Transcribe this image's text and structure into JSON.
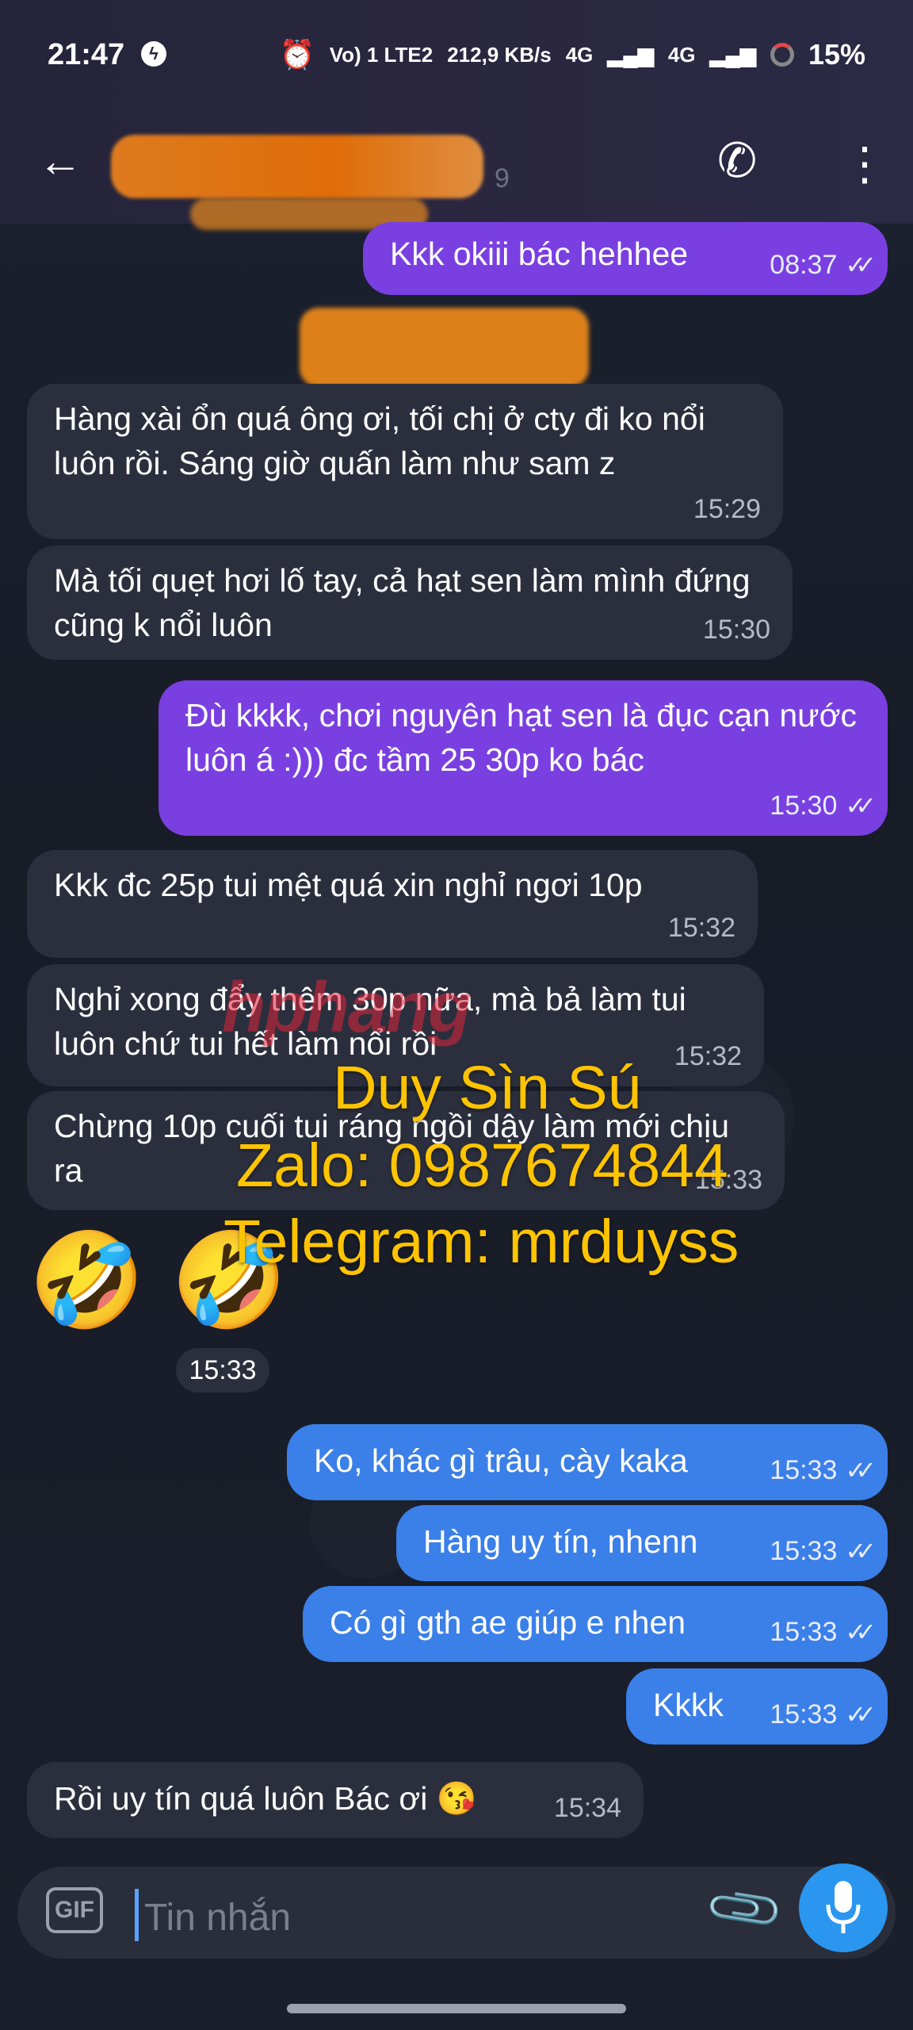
{
  "status": {
    "time": "21:47",
    "network1": "Vo) 1 LTE2",
    "speed": "212,9 KB/s",
    "net4g_1": "4G",
    "net4g_2": "4G",
    "battery": "15%"
  },
  "header": {
    "title_partial": "9"
  },
  "messages": [
    {
      "text": "Kkk okiii bác hehhee",
      "time": "08:37"
    },
    {
      "text": "Hàng xài ổn quá ông ơi, tối chị ở cty đi ko nổi luôn rồi. Sáng giờ quấn làm như sam z",
      "time": "15:29"
    },
    {
      "text": "Mà tối quẹt hơi lố tay, cả hạt sen làm mình đứng cũng k nổi luôn",
      "time": "15:30"
    },
    {
      "text": "Đù kkkk, chơi nguyên hạt sen là đục cạn nước luôn á :))) đc tầm 25 30p ko bác",
      "time": "15:30"
    },
    {
      "text": "Kkk đc 25p tui mệt quá xin nghỉ ngơi 10p",
      "time": "15:32"
    },
    {
      "text": "Nghỉ xong đẩy thêm 30p nữa, mà bả làm tui luôn chứ tui hết làm nổi rồi",
      "time": "15:32"
    },
    {
      "text": "Chừng 10p cuối tui ráng ngồi dậy làm mới chịu ra",
      "time": "15:33"
    },
    {
      "text": "🤣 🤣",
      "time": "15:33"
    },
    {
      "text": "Ko, khác gì trâu, cày kaka",
      "time": "15:33"
    },
    {
      "text": "Hàng uy tín, nhenn",
      "time": "15:33"
    },
    {
      "text": "Có gì gth ae giúp e nhen",
      "time": "15:33"
    },
    {
      "text": "Kkkk",
      "time": "15:33"
    },
    {
      "text": "Rồi uy tín quá luôn Bác ơi 😘",
      "time": "15:34"
    }
  ],
  "watermark": {
    "brand": "hphang",
    "name": "Duy Sìn Sú",
    "zalo": "Zalo: 0987674844",
    "telegram": "Telegram: mrduyss"
  },
  "composer": {
    "gif_label": "GIF",
    "placeholder": "Tin nhắn"
  },
  "ticks": "✓✓",
  "colors": {
    "incoming": "#2b2f3d",
    "outgoing_purple": "#7a3fe0",
    "outgoing_blue": "#3b7fe8",
    "watermark": "#ffc400",
    "mic": "#2a96f0"
  }
}
